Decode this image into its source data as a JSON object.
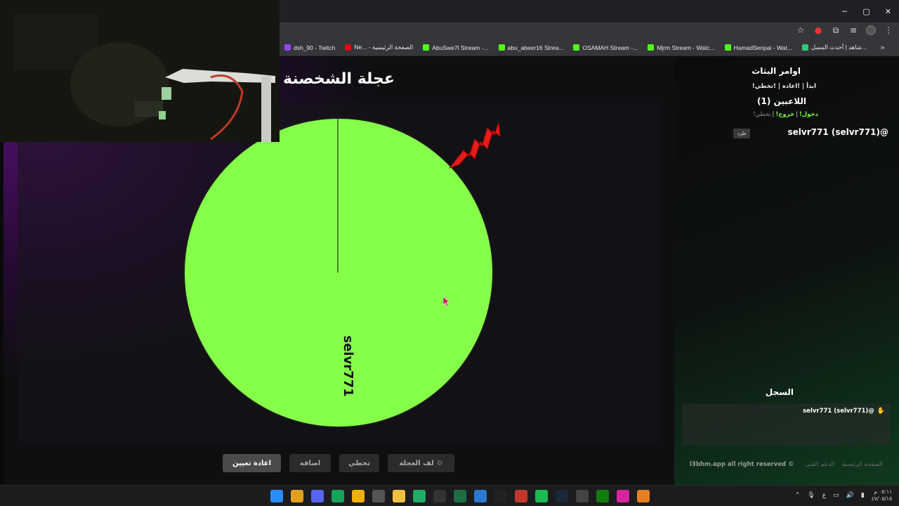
{
  "browser": {
    "window_controls": {
      "minimize": "─",
      "maximize": "▢",
      "close": "✕"
    },
    "bookmarks": [
      {
        "label": "dsh_90 - Twitch",
        "color": "#9146ff"
      },
      {
        "label": "Ne... - الصفحة الرئيسية",
        "color": "#e50914"
      },
      {
        "label": "AbuSwe7l Stream -...",
        "color": "#53fc18"
      },
      {
        "label": "abu_abeer16 Strea...",
        "color": "#53fc18"
      },
      {
        "label": "OSAMAH Stream -...",
        "color": "#53fc18"
      },
      {
        "label": "Mjrm Stream - Watc...",
        "color": "#53fc18"
      },
      {
        "label": "HamadSenpai - Wat...",
        "color": "#53fc18"
      },
      {
        "label": "شاهد | أحدث المسل...",
        "color": "#2ecc71"
      }
    ],
    "bookmarks_more": "»"
  },
  "page": {
    "title": "عجلة الشخصنة"
  },
  "wheel": {
    "segments": [
      {
        "label": "selvr771",
        "color": "#85ff4a"
      }
    ]
  },
  "sidebar": {
    "title": "اوامر البثاث",
    "commands": "!ابدأ | !اعاده | !تخطي",
    "players_title": "اللاعبين (1)",
    "action_join": "!دخول",
    "action_leave": "!خروج",
    "action_skip": "!تخطي",
    "separator": "|",
    "kick_label": "طرد",
    "player": "selvr771 (selvr771)@",
    "log_title": "السجل",
    "log_entry": "selvr771 (selvr771)@"
  },
  "buttons": {
    "reset": "اعادة تعيين",
    "add": "اضافه",
    "skip": "تخطي",
    "spin": "لف العجلة"
  },
  "footer": {
    "copyright": "l3bhm.app all right reserved ©",
    "support": "الدعم الفني",
    "home": "الصفحة الرئيسية"
  },
  "taskbar": {
    "time": "٠٥:١١ م",
    "date": "٤٧/٠٥/١٥",
    "lang": "ع",
    "apps": [
      {
        "name": "windows-start",
        "color": "#2d8cff"
      },
      {
        "name": "chrome",
        "color": "#e0a020"
      },
      {
        "name": "discord",
        "color": "#5865f2"
      },
      {
        "name": "app-green",
        "color": "#17a45a"
      },
      {
        "name": "app-yellow",
        "color": "#f0b000"
      },
      {
        "name": "app-grey",
        "color": "#555"
      },
      {
        "name": "file-explorer",
        "color": "#f0c040"
      },
      {
        "name": "app-store",
        "color": "#2a6"
      },
      {
        "name": "app-dark",
        "color": "#333"
      },
      {
        "name": "excel",
        "color": "#1d6f42"
      },
      {
        "name": "calendar",
        "color": "#2b79d0"
      },
      {
        "name": "epic-games",
        "color": "#222"
      },
      {
        "name": "xsplit",
        "color": "#c0392b"
      },
      {
        "name": "spotify",
        "color": "#1db954"
      },
      {
        "name": "steam",
        "color": "#1b2838"
      },
      {
        "name": "app-white",
        "color": "#444"
      },
      {
        "name": "xbox",
        "color": "#107c10"
      },
      {
        "name": "instagram",
        "color": "#d6249f"
      },
      {
        "name": "app-orange",
        "color": "#e67e22"
      }
    ]
  }
}
